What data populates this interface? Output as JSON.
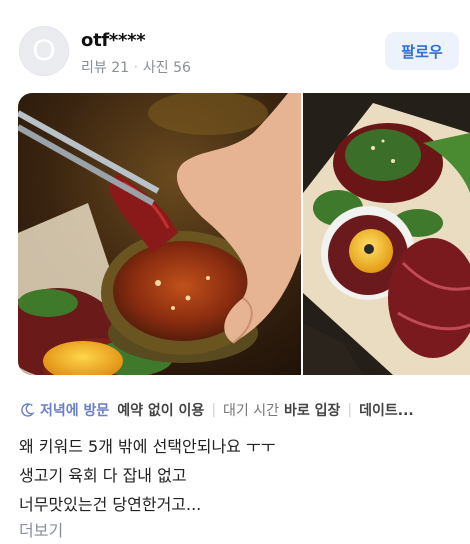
{
  "user": {
    "avatar_initial": "O",
    "name": "otf****",
    "reviews": "리뷰 21",
    "separator": "·",
    "photos": "사진 56"
  },
  "follow_label": "팔로우",
  "tags": {
    "visit_time": "저녁에 방문",
    "reservation": "예약 없이 이용",
    "wait_label": "대기 시간",
    "wait_value": "바로 입장",
    "purpose": "데이트..."
  },
  "review_lines": [
    "왜 키워드 5개 밖에 선택안되나요 ㅜㅜ",
    "생고기 육회 다 잡내 없고",
    "너무맛있는건 당연한거고..."
  ],
  "more_label": "더보기",
  "colors": {
    "follow_text": "#2f6fd6",
    "follow_bg": "#eef3fb",
    "visit_tag": "#6b7fc7"
  },
  "icons": {
    "visit_time": "moon-icon"
  }
}
